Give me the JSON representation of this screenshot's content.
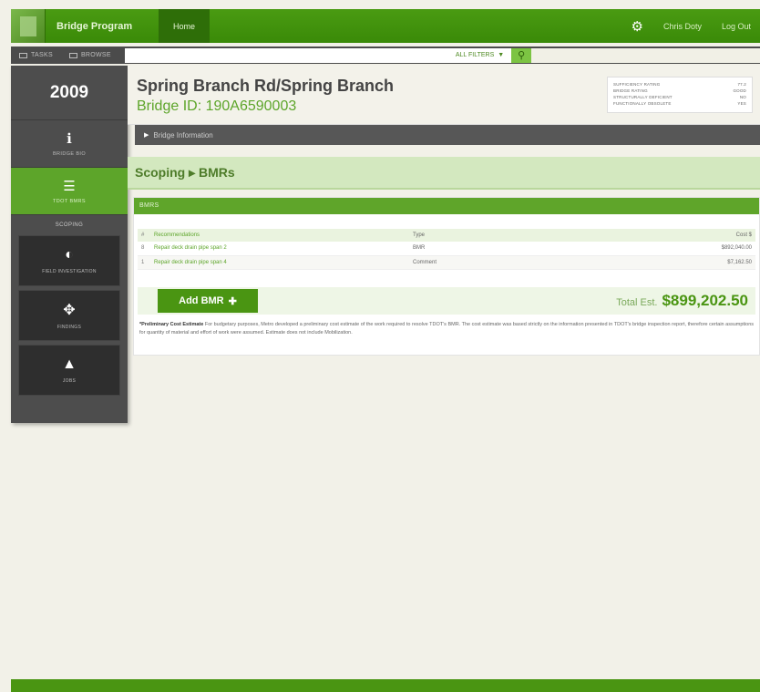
{
  "topbar": {
    "app_title": "Bridge Program",
    "home_tab": "Home",
    "user_name": "Chris Doty",
    "logout": "Log Out"
  },
  "toolbar": {
    "tasks_tab": "TASKS",
    "browse_tab": "BROWSE",
    "search_value": "",
    "filters_label": "ALL FILTERS"
  },
  "sidebar": {
    "year": "2009",
    "items": [
      {
        "label": "BRIDGE BIO",
        "icon": "info-icon"
      },
      {
        "label": "TDOT BMRS",
        "icon": "list-icon"
      }
    ],
    "section_label": "SCOPING",
    "blocks": [
      {
        "label": "FIELD INVESTIGATION",
        "icon": "field-investigation-icon"
      },
      {
        "label": "FINDINGS",
        "icon": "findings-icon"
      },
      {
        "label": "JOBS",
        "icon": "jobs-icon"
      }
    ]
  },
  "header": {
    "bridge_name": "Spring Branch Rd/Spring Branch",
    "bridge_id": "Bridge ID: 190A6590003",
    "ratings": [
      {
        "label": "SUFFICIENCY RATING",
        "value": "77.2"
      },
      {
        "label": "BRIDGE RATING",
        "value": "GOOD"
      },
      {
        "label": "STRUCTURALLY DEFICIENT",
        "value": "NO"
      },
      {
        "label": "FUNCTIONALLY OBSOLETE",
        "value": "YES"
      }
    ]
  },
  "info_bar": {
    "label": "Bridge Information"
  },
  "scope_bar": {
    "title": "Scoping ▸ BMRs"
  },
  "panel": {
    "title": "BMRS",
    "headers": {
      "num": "#",
      "rec": "Recommendations",
      "type": "Type",
      "cost": "Cost $"
    },
    "rows": [
      {
        "num": "8",
        "rec": "Repair deck drain pipe span 2",
        "type": "BMR",
        "cost": "$892,040.00"
      },
      {
        "num": "1",
        "rec": "Repair deck drain pipe span 4",
        "type": "Comment",
        "cost": "$7,162.50"
      }
    ],
    "add_button": "Add BMR",
    "total_label": "Total Est.",
    "total_value": "$899,202.50",
    "disclaimer_bold": "*Preliminary Cost Estimate",
    "disclaimer_text": " For budgetary purposes, Metro developed a preliminary cost estimate of the work required to resolve TDOT's BMR. The cost estimate was based strictly on the information presented in TDOT's bridge inspection report, therefore certain assumptions for quantity of material and effort of work were assumed. Estimate does not include Mobilization."
  }
}
